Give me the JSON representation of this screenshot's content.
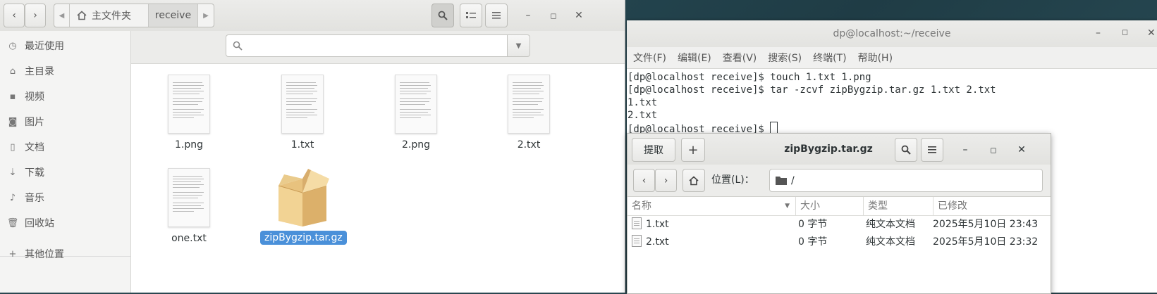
{
  "file_manager": {
    "path": {
      "home_label": "主文件夹",
      "current": "receive"
    },
    "sidebar": [
      {
        "label": "最近使用",
        "icon": "clock-icon"
      },
      {
        "label": "主目录",
        "icon": "home-icon"
      },
      {
        "label": "视频",
        "icon": "video-icon"
      },
      {
        "label": "图片",
        "icon": "camera-icon"
      },
      {
        "label": "文档",
        "icon": "document-icon"
      },
      {
        "label": "下载",
        "icon": "download-icon"
      },
      {
        "label": "音乐",
        "icon": "music-icon"
      },
      {
        "label": "回收站",
        "icon": "trash-icon"
      },
      {
        "label": "其他位置",
        "icon": "plus-icon"
      }
    ],
    "files": [
      {
        "name": "1.png",
        "type": "document"
      },
      {
        "name": "1.txt",
        "type": "document"
      },
      {
        "name": "2.png",
        "type": "document"
      },
      {
        "name": "2.txt",
        "type": "document"
      },
      {
        "name": "one.txt",
        "type": "document"
      },
      {
        "name": "zipBygzip.tar.gz",
        "type": "archive",
        "selected": true
      }
    ],
    "selection_color": "#4a90d9"
  },
  "terminal": {
    "title": "dp@localhost:~/receive",
    "menu": [
      "文件(F)",
      "编辑(E)",
      "查看(V)",
      "搜索(S)",
      "终端(T)",
      "帮助(H)"
    ],
    "lines": [
      "[dp@localhost receive]$ touch 1.txt 1.png",
      "[dp@localhost receive]$ tar -zcvf zipBygzip.tar.gz 1.txt 2.txt",
      "1.txt",
      "2.txt",
      "[dp@localhost receive]$ "
    ]
  },
  "archive": {
    "extract_label": "提取",
    "add_label": "+",
    "title": "zipBygzip.tar.gz",
    "location_label": "位置(L)：",
    "location_value": "/",
    "columns": [
      "名称",
      "大小",
      "类型",
      "已修改"
    ],
    "rows": [
      {
        "name": "1.txt",
        "size": "0 字节",
        "type": "纯文本文档",
        "modified": "2025年5月10日 23:43"
      },
      {
        "name": "2.txt",
        "size": "0 字节",
        "type": "纯文本文档",
        "modified": "2025年5月10日 23:32"
      }
    ]
  }
}
